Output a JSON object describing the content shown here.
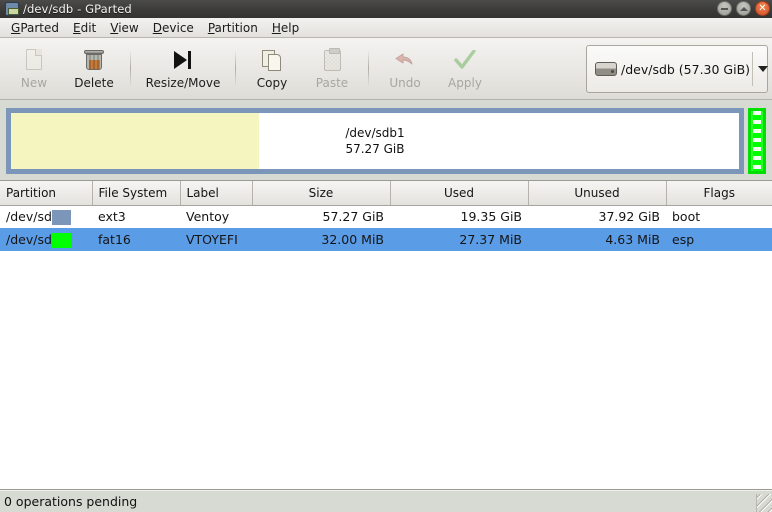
{
  "window": {
    "title": "/dev/sdb - GParted",
    "icon": "gparted-icon",
    "buttons": {
      "minimize": "minimize-button",
      "maximize": "maximize-button",
      "close": "✕"
    }
  },
  "menubar": {
    "items": [
      {
        "label": "GParted",
        "mnemonic": "G"
      },
      {
        "label": "Edit",
        "mnemonic": "E"
      },
      {
        "label": "View",
        "mnemonic": "V"
      },
      {
        "label": "Device",
        "mnemonic": "D"
      },
      {
        "label": "Partition",
        "mnemonic": "P"
      },
      {
        "label": "Help",
        "mnemonic": "H"
      }
    ]
  },
  "toolbar": {
    "new_label": "New",
    "delete_label": "Delete",
    "resize_move_label": "Resize/Move",
    "copy_label": "Copy",
    "paste_label": "Paste",
    "undo_label": "Undo",
    "apply_label": "Apply",
    "device_selector": {
      "icon": "hard-disk-icon",
      "value": "/dev/sdb  (57.30 GiB)",
      "arrow": "chevron-down-icon"
    }
  },
  "graphic": {
    "partitions": [
      {
        "name": "/dev/sdb1",
        "size": "57.27 GiB",
        "border_color": "#7b96b8",
        "used_color": "#f5f5c0",
        "unused_color": "#ffffff",
        "used_percent": 34
      },
      {
        "name": "/dev/sdb2",
        "size": "32.00 MiB",
        "border_color": "#00e000",
        "used_color": "#00ff00",
        "unused_color": "#f2fff2",
        "used_percent": 86
      }
    ]
  },
  "table": {
    "headers": {
      "partition": "Partition",
      "filesystem": "File System",
      "label": "Label",
      "size": "Size",
      "used": "Used",
      "unused": "Unused",
      "flags": "Flags"
    },
    "rows": [
      {
        "partition": "/dev/sdb1",
        "swatch_color": "#7b96b8",
        "filesystem": "ext3",
        "label": "Ventoy",
        "size": "57.27 GiB",
        "used": "19.35 GiB",
        "unused": "37.92 GiB",
        "flags": "boot",
        "selected": false
      },
      {
        "partition": "/dev/sdb2",
        "swatch_color": "#00ff00",
        "filesystem": "fat16",
        "label": "VTOYEFI",
        "size": "32.00 MiB",
        "used": "27.37 MiB",
        "unused": "4.63 MiB",
        "flags": "esp",
        "selected": true
      }
    ]
  },
  "statusbar": {
    "text": "0 operations pending"
  },
  "colors": {
    "selection": "#5b9ce6",
    "chrome": "#d6dad2",
    "titlebar": "#3c3b39",
    "close_button": "#d1502a"
  }
}
